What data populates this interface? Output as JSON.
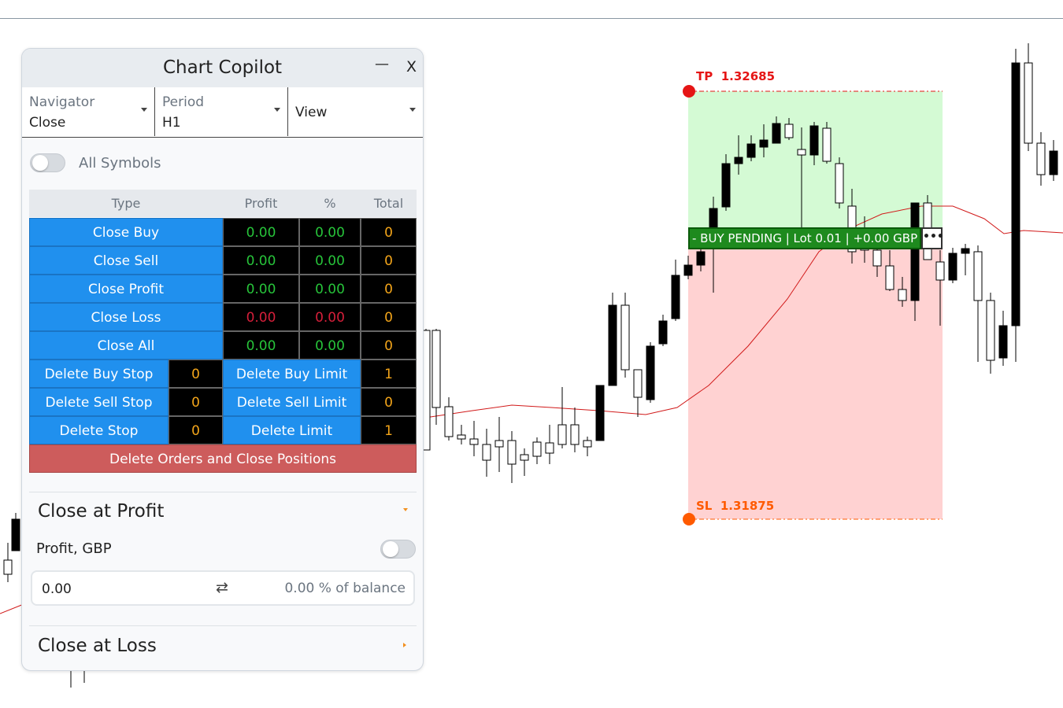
{
  "chart": {
    "tp_label": "TP",
    "tp_price": "1.32685",
    "sl_label": "SL",
    "sl_price": "1.31875",
    "pending_text": "- BUY PENDING | Lot 0.01 | +0.00 GBP",
    "more_label": "•••",
    "colors": {
      "tp": "#e51515",
      "sl": "#ff5a00",
      "tp_zone": "#d4fad4",
      "sl_zone": "#ffd2d2",
      "ma": "#d11a1a",
      "pending": "#1e8a1e"
    }
  },
  "panel": {
    "title": "Chart Copilot",
    "minimize_label": "—",
    "close_label": "X",
    "selectors": [
      {
        "label": "Navigator",
        "value": "Close"
      },
      {
        "label": "Period",
        "value": "H1"
      },
      {
        "label": "View"
      }
    ],
    "all_symbols_label": "All Symbols",
    "all_symbols_on": false,
    "table": {
      "headers": [
        "Type",
        "Profit",
        "%",
        "Total"
      ],
      "rows": [
        {
          "label": "Close Buy",
          "profit": "0.00",
          "percent": "0.00",
          "total": "0"
        },
        {
          "label": "Close Sell",
          "profit": "0.00",
          "percent": "0.00",
          "total": "0"
        },
        {
          "label": "Close Profit",
          "profit": "0.00",
          "percent": "0.00",
          "total": "0"
        },
        {
          "label": "Close Loss",
          "profit": "0.00",
          "percent": "0.00",
          "total": "0"
        },
        {
          "label": "Close All",
          "profit": "0.00",
          "percent": "0.00",
          "total": "0"
        }
      ],
      "delete_rows": [
        {
          "left_label": "Delete Buy Stop",
          "left_count": "0",
          "right_label": "Delete Buy Limit",
          "right_count": "1"
        },
        {
          "left_label": "Delete Sell Stop",
          "left_count": "0",
          "right_label": "Delete Sell Limit",
          "right_count": "0"
        },
        {
          "left_label": "Delete Stop",
          "left_count": "0",
          "right_label": "Delete Limit",
          "right_count": "1"
        }
      ],
      "delete_all_label": "Delete Orders and Close Positions"
    },
    "close_at_profit": {
      "title": "Close at Profit",
      "field_label": "Profit, GBP",
      "enabled": false,
      "value": "0.00",
      "swap_icon": "⇄",
      "percent_text": "0.00 % of balance"
    },
    "close_at_loss": {
      "title": "Close at Loss"
    }
  }
}
